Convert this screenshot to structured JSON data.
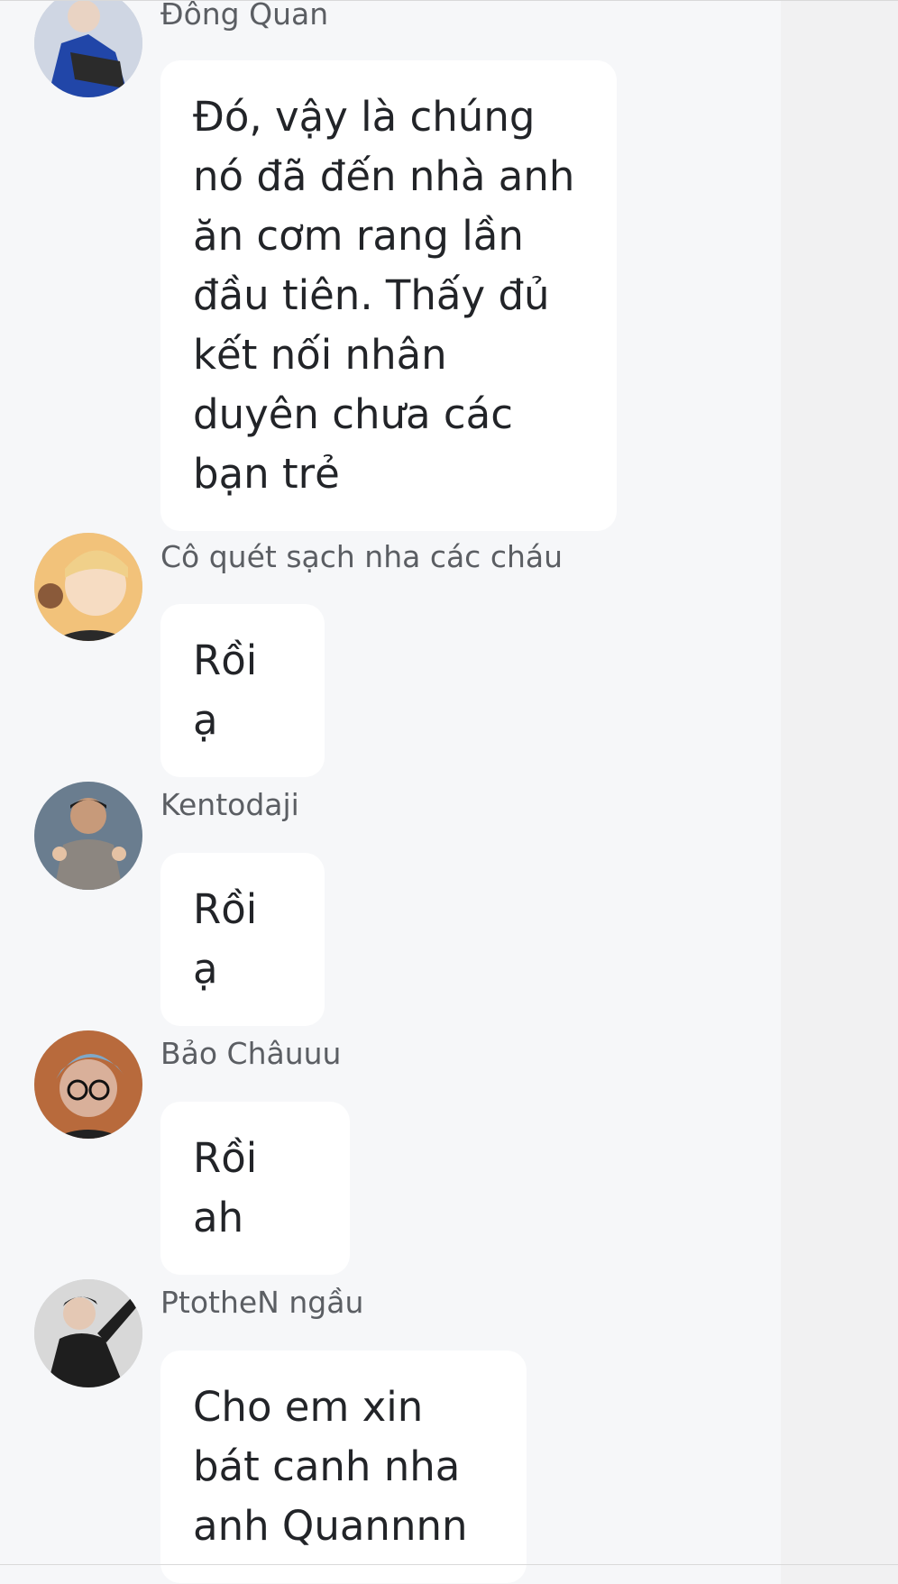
{
  "messages": [
    {
      "sender": "Đông Quan",
      "text": "Đó, vậy là chúng nó đã đến nhà anh ăn cơm rang lần đầu tiên. Thấy đủ kết nối nhân duyên chưa các bạn trẻ",
      "avatar_icon": "user-avatar"
    },
    {
      "sender": "Cô quét sạch nha các cháu",
      "text": "Rồi ạ",
      "avatar_icon": "user-avatar"
    },
    {
      "sender": "Kentodaji",
      "text": "Rồi ạ",
      "avatar_icon": "user-avatar"
    },
    {
      "sender": "Bảo Châuuu",
      "text": "Rồi ah",
      "avatar_icon": "user-avatar"
    },
    {
      "sender": "PtotheN ngầu",
      "text": "Cho em xin bát canh nha anh Quannnn",
      "avatar_icon": "user-avatar"
    }
  ],
  "menu_icon": "hamburger-menu-icon",
  "colors": {
    "background": "#f6f7f9",
    "bubble": "#ffffff",
    "text": "#222428",
    "sender": "#5b5e63"
  }
}
